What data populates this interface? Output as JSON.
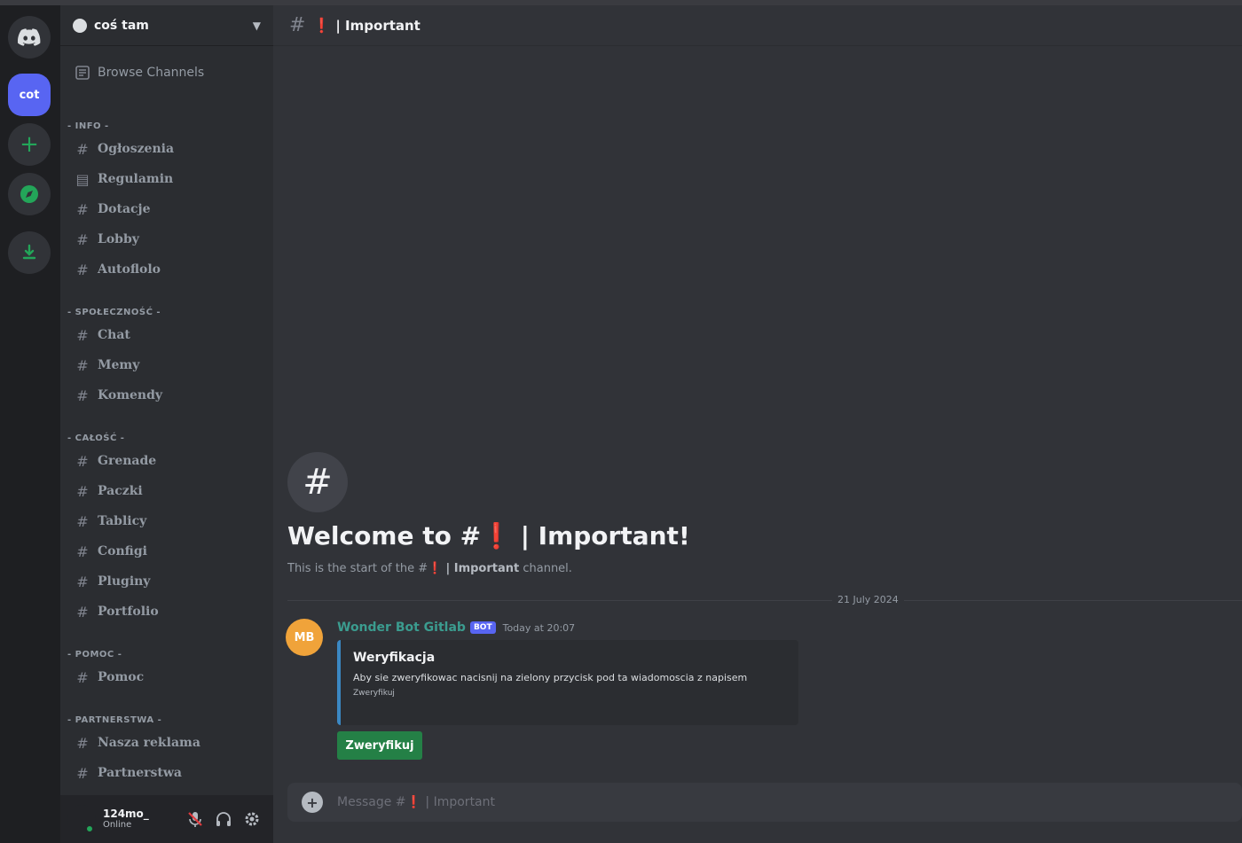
{
  "servers": [
    {
      "name": "discord-home-icon"
    },
    {
      "label": "cot"
    },
    {
      "label": "+"
    },
    {
      "name": "explore-icon"
    },
    {
      "name": "download-icon"
    }
  ],
  "guild": {
    "name": "coś tam"
  },
  "sidebar": {
    "browse": "Browse Channels",
    "categories": [
      {
        "label": "- INFO -",
        "channels": [
          "Ogłoszenia",
          "Regulamin",
          "Dotacje",
          "Lobby",
          "Autoflolo"
        ]
      },
      {
        "label": "- SPOŁECZNOŚĆ -",
        "channels": [
          "Chat",
          "Memy",
          "Komendy"
        ]
      },
      {
        "label": "- CAŁOŚĆ -",
        "channels": [
          "Grenade",
          "Paczki",
          "Tablicy",
          "Configi",
          "Pluginy",
          "Portfolio"
        ]
      },
      {
        "label": "- POMOC -",
        "channels": [
          "Pomoc"
        ]
      },
      {
        "label": "- PARTNERSTWA -",
        "channels": [
          "Nasza reklama",
          "Partnerstwa"
        ]
      }
    ]
  },
  "user": {
    "name": "124mo_",
    "status": "Online"
  },
  "channel": {
    "emoji": "❗",
    "name": "| Important"
  },
  "welcome": {
    "title_prefix": "Welcome to #",
    "title_emoji": "❗",
    "title_name": "| Important!",
    "sub_prefix": "This is the start of the #",
    "sub_emoji": "❗",
    "sub_name": "| Important",
    "sub_suffix": " channel."
  },
  "date_divider": "21 July 2024",
  "message": {
    "avatar_text": "MB",
    "author": "Wonder Bot Gitlab",
    "bot_tag": "BOT",
    "time": "Today at 20:07",
    "embed": {
      "title": "Weryfikacja",
      "description": "Aby sie zweryfikowac nacisnij na zielony przycisk pod ta wiadomoscia z napisem",
      "footer": "Zweryfikuj"
    },
    "button": "Zweryfikuj"
  },
  "composer": {
    "placeholder": "Message #❗ | Important"
  },
  "colors": {
    "accent": "#5865f2",
    "online": "#23a559",
    "verify": "#248046",
    "author": "#3b9c8f"
  }
}
